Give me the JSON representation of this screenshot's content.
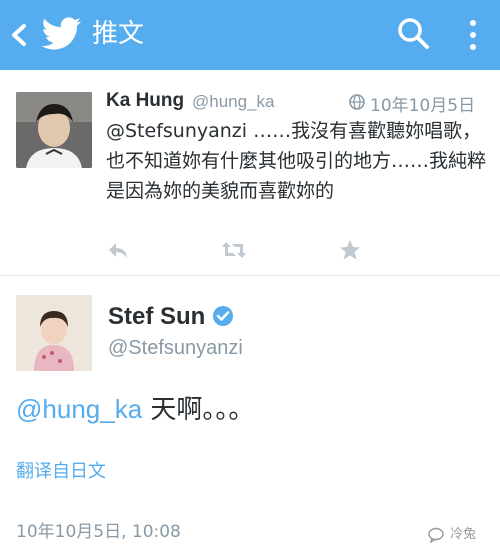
{
  "header": {
    "title": "推文",
    "background": "#55acee",
    "icons": [
      "back-icon",
      "twitter-bird-icon",
      "search-icon",
      "more-vertical-icon"
    ]
  },
  "tweet1": {
    "name": "Ka Hung",
    "handle": "@hung_ka",
    "date": "10年10月5日",
    "text": "@Stefsunyanzi ……我沒有喜歡聽妳唱歌，也不知道妳有什麼其他吸引的地方……我純粹是因為妳的美貌而喜歡妳的",
    "actions": [
      "reply-icon",
      "retweet-icon",
      "favorite-icon"
    ]
  },
  "tweet2": {
    "name": "Stef Sun",
    "handle": "@Stefsunyanzi",
    "mention": "@hung_ka",
    "text": " 天啊。。。",
    "translate": "翻译自日文",
    "timestamp": "10年10月5日, 10:08"
  },
  "watermark": {
    "text": "冷兔"
  },
  "colors": {
    "accent": "#55acee",
    "muted": "#8899a6",
    "text": "#292f33",
    "verified": "#55acee"
  }
}
